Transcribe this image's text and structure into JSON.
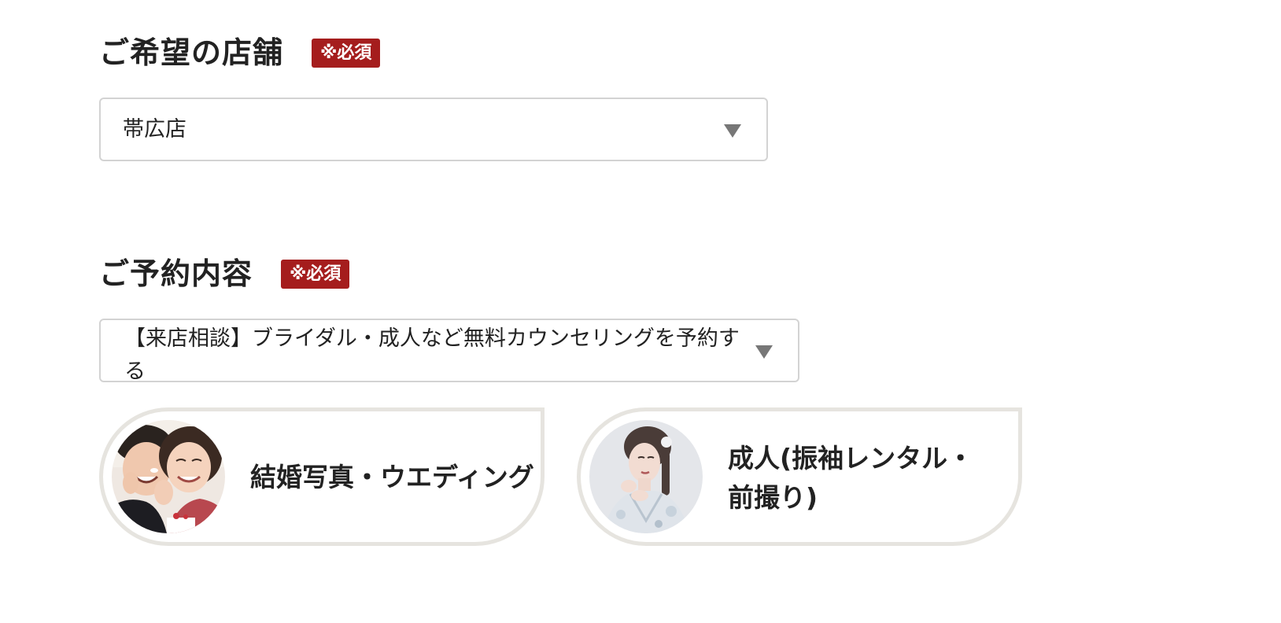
{
  "store_section": {
    "title": "ご希望の店舗",
    "required": "※必須",
    "selected": "帯広店"
  },
  "content_section": {
    "title": "ご予約内容",
    "required": "※必須",
    "selected": "【来店相談】ブライダル・成人など無料カウンセリングを予約する"
  },
  "options": [
    {
      "label": "結婚写真・ウエディング",
      "icon": "wedding-couple-photo"
    },
    {
      "label": "成人(振袖レンタル・前撮り)",
      "icon": "furisode-woman-photo"
    }
  ],
  "colors": {
    "required_badge": "#a51d1d",
    "card_border": "#e6e4df",
    "select_border": "#d3d3d3",
    "arrow": "#777777"
  }
}
